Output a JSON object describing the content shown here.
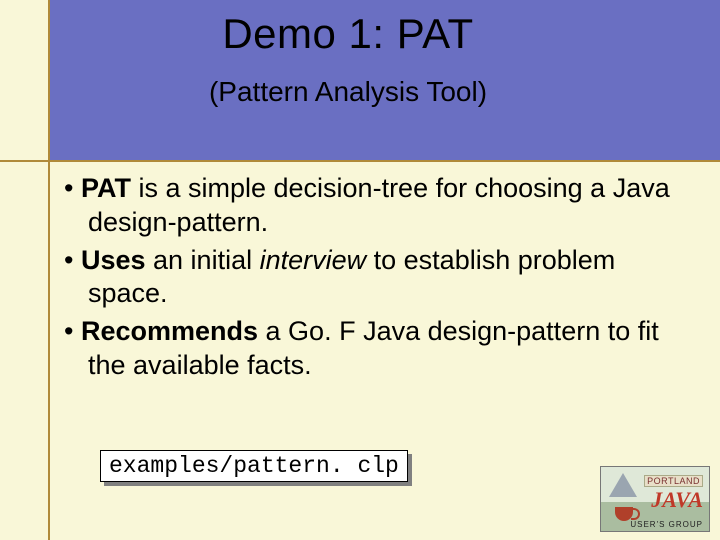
{
  "title": "Demo 1: PAT",
  "subtitle": "(Pattern Analysis Tool)",
  "bullets": [
    {
      "strong": "PAT",
      "rest": " is a simple decision-tree for choosing a Java design-pattern.",
      "ital": ""
    },
    {
      "prefix": "Uses",
      "mid": " an initial ",
      "ital": "interview",
      "rest": " to establish problem space."
    },
    {
      "prefix": "Recommends",
      "rest2": " a Go. F Java design-pattern to fit the available facts."
    }
  ],
  "codebox": "examples/pattern. clp",
  "logo": {
    "top": "PORTLAND",
    "name": "JAVA",
    "sub": "USER'S GROUP"
  }
}
